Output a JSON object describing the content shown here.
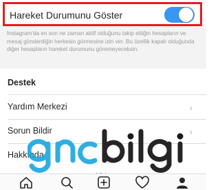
{
  "settings": {
    "activity_toggle": {
      "label": "Hareket Durumunu Göster",
      "enabled": true,
      "accent_color": "#3897f0",
      "highlight_color": "#e51b23"
    },
    "description": "Instagram'da en son ne zaman aktif olduğunu takip ettiğin hesapların ve mesaj gönderdiğin herkesin görmesine izin ver. Bu özellik kapalı olduğunda diğer hesapların hareket durumunu göremeyeceksin.",
    "support_section": {
      "title": "Destek",
      "items": [
        {
          "label": "Yardım Merkezi"
        },
        {
          "label": "Sorun Bildir"
        },
        {
          "label": "Hakkında"
        }
      ]
    }
  },
  "watermark": {
    "brand_left": "gnc",
    "brand_right": "bilgi",
    "url": "www.gncbilgi.com",
    "left_color": "#1ea8e0",
    "right_color": "#1a1a1a"
  },
  "tabbar": {
    "icons": [
      "home-icon",
      "search-icon",
      "add-post-icon",
      "heart-icon",
      "profile-icon"
    ]
  }
}
